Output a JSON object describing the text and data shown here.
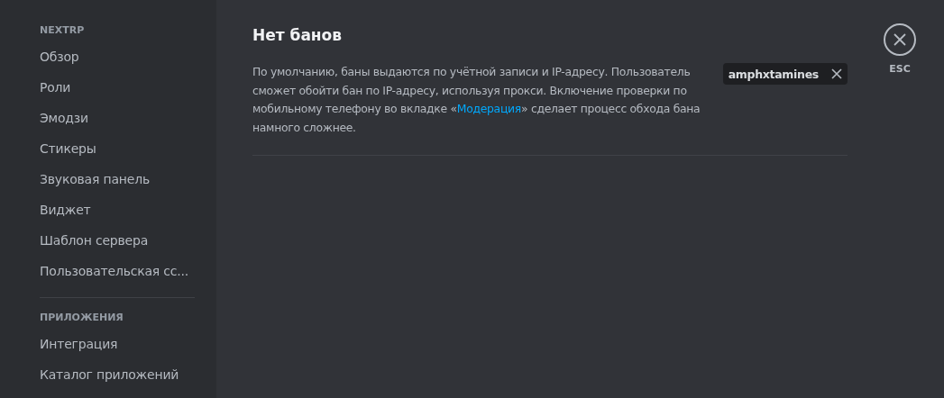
{
  "sidebar": {
    "sections": [
      {
        "header": "NEXTRP",
        "items": [
          "Обзор",
          "Роли",
          "Эмодзи",
          "Стикеры",
          "Звуковая панель",
          "Виджет",
          "Шаблон сервера",
          "Пользовательская сс..."
        ]
      },
      {
        "header": "ПРИЛОЖЕНИЯ",
        "items": [
          "Интеграция",
          "Каталог приложений"
        ]
      }
    ]
  },
  "content": {
    "title": "Нет банов",
    "description": {
      "before": "По умолчанию, баны выдаются по учётной записи и IP-адресу. Пользователь сможет обойти бан по IP-адресу, используя прокси. Включение проверки по мобильному телефону во вкладке «",
      "link": "Модерация",
      "after": "» сделает процесс обхода бана намного сложнее."
    },
    "filter_tag": "amphxtamines"
  },
  "close": {
    "label": "ESC"
  }
}
